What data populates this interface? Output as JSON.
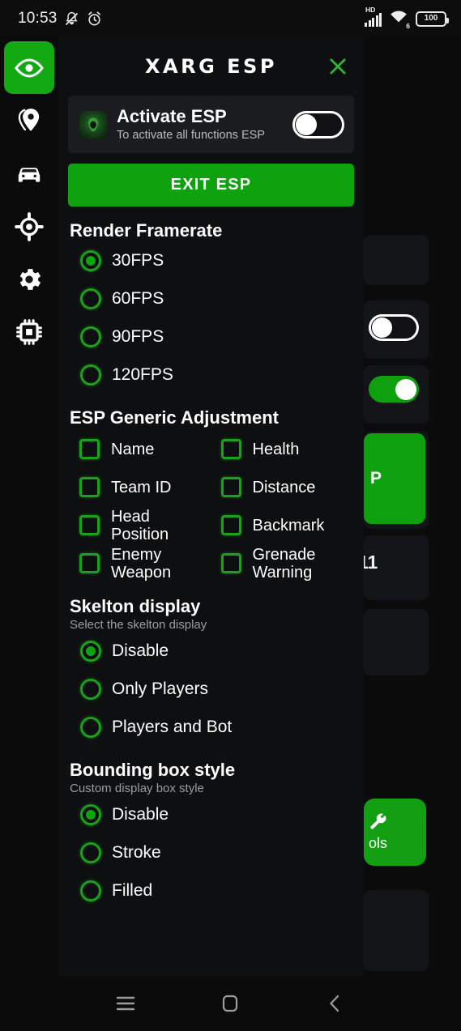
{
  "status_bar": {
    "time": "10:53",
    "icons_left": [
      "silent-bell-icon",
      "alarm-clock-icon"
    ],
    "network_label": "HD",
    "wifi_label": "6",
    "battery": "100"
  },
  "rail": {
    "eye_button": "eye-icon",
    "items": [
      {
        "icon": "location-pin-icon",
        "name": "rail-item-location"
      },
      {
        "icon": "car-icon",
        "name": "rail-item-vehicle"
      },
      {
        "icon": "crosshair-icon",
        "name": "rail-item-aim"
      },
      {
        "icon": "gear-icon",
        "name": "rail-item-settings"
      },
      {
        "icon": "chip-icon",
        "name": "rail-item-memory"
      }
    ]
  },
  "panel": {
    "title": "XARG ESP",
    "close_icon": "close-icon",
    "activate": {
      "title": "Activate ESP",
      "subtitle": "To activate all functions ESP",
      "toggle_state": "off"
    },
    "exit_label": "EXIT ESP",
    "framerate": {
      "heading": "Render Framerate",
      "selected": "30FPS",
      "options": [
        "30FPS",
        "60FPS",
        "90FPS",
        "120FPS"
      ]
    },
    "generic": {
      "heading": "ESP Generic Adjustment",
      "options": [
        {
          "label": "Name",
          "checked": false
        },
        {
          "label": "Health",
          "checked": false
        },
        {
          "label": "Team ID",
          "checked": false
        },
        {
          "label": "Distance",
          "checked": false
        },
        {
          "label": "Head Position",
          "checked": false
        },
        {
          "label": "Backmark",
          "checked": false
        },
        {
          "label": "Enemy Weapon",
          "checked": false
        },
        {
          "label": "Grenade Warning",
          "checked": false
        }
      ]
    },
    "skelton": {
      "heading": "Skelton display",
      "subtitle": "Select the skelton display",
      "selected": "Disable",
      "options": [
        "Disable",
        "Only Players",
        "Players and Bot"
      ]
    },
    "bounding": {
      "heading": "Bounding box style",
      "subtitle": "Custom display box style",
      "selected": "Disable",
      "options": [
        "Disable",
        "Stroke",
        "Filled"
      ]
    }
  },
  "background_app": {
    "button_text": "P",
    "number_text": "11",
    "tile_label": "ols"
  },
  "nav_bar": {
    "recents": "menu-icon",
    "home": "home-icon",
    "back": "back-icon"
  },
  "colors": {
    "accent_green": "#0fa20f",
    "outline_green": "#18a318",
    "panel_bg": "#0e0f11",
    "card_bg": "#1a1c1f"
  }
}
